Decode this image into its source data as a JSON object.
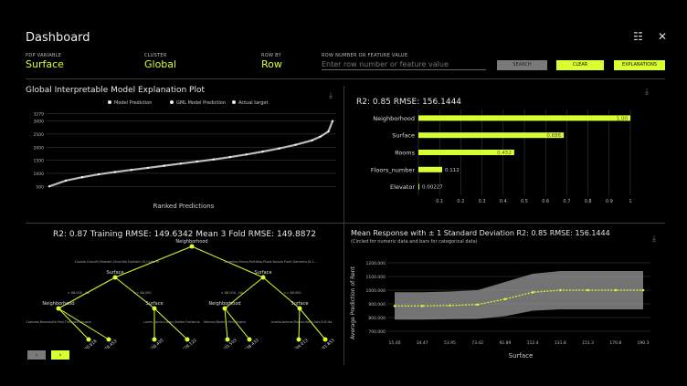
{
  "header": {
    "title": "Dashboard",
    "grid_icon": "grid-icon",
    "close_icon": "close-icon"
  },
  "controls": {
    "pdp_variable": {
      "label": "PDP VARIABLE",
      "value": "Surface"
    },
    "cluster": {
      "label": "CLUSTER",
      "value": "Global"
    },
    "row_by": {
      "label": "ROW BY",
      "value": "Row"
    },
    "feature": {
      "label": "ROW NUMBER OR FEATURE VALUE",
      "placeholder": "Enter row number or feature value"
    },
    "search_label": "SEARCH",
    "clear_label": "CLEAR",
    "explanations_label": "EXPLANATIONS"
  },
  "panels": {
    "global": {
      "title": "Global Interpretable Model Explanation Plot",
      "xlabel": "Ranked Predictions",
      "legend": [
        "Model Prediction",
        "GML Model Prediction",
        "Actual target"
      ]
    },
    "importance": {
      "title": "R2: 0.85 RMSE: 156.1444"
    },
    "tree": {
      "title": "R2: 0.87 Training RMSE: 149.6342 Mean 3 Fold RMSE: 149.8872",
      "root": "Neighborhood",
      "root_values": "Cavalo,Grocelli,Ramaiti,Chochtik,Dolhalm,SI,Uniform",
      "root_values_right": "Angelino,Parral,Portfolio,Plaza Nuova,Front,Sorrento,St.L...",
      "split_left": "Surface",
      "split_right": "Surface",
      "edge_l1": "< 88.000 , NA",
      "edge_l2": ">= 88.000",
      "edge_r1": "< 88.000 , NA",
      "edge_r2": ">= 88.000",
      "l_neigh": "Neighborhood",
      "l_surf": "Surface",
      "r_neigh": "Neighborhood",
      "r_surf": "Surface",
      "leaf_l_values": "Colorado,Brownsville,Park,Thompson,Angelo",
      "leaf_l_values2": "Lorem,Sanford,Arms,Shelter,Fortlaurio",
      "leaf_r_values": "Marconi,Bodmin,Park,Angelo",
      "leaf_r_values2": "Aurelia,Avenue,Pizzulo,Hosel,Sole,SUE,Ilia",
      "leaves": [
        "930.618",
        "978.453",
        "1106.405",
        "1029.122",
        "1105.503",
        "1038.433",
        "1194.013",
        "1181.853"
      ]
    },
    "pdp": {
      "title": "Mean Response with ± 1 Standard Deviation R2: 0.85 RMSE: 156.1444",
      "subtitle": "(Circled for numeric data and bars for categorical data)",
      "xlabel": "Surface",
      "ylabel": "Average Prediction of Rent"
    }
  },
  "pager": {
    "prev": "‹",
    "next": "›"
  },
  "chart_data": [
    {
      "type": "scatter",
      "title": "Global Interpretable Model Explanation Plot",
      "xlabel": "Ranked Predictions",
      "ylabel": "",
      "yticks": [
        "500",
        "1000",
        "1500",
        "2000",
        "2500",
        "3000",
        "3279"
      ],
      "ylim": [
        300,
        3300
      ],
      "series": [
        {
          "name": "Model Prediction",
          "x": [
            0,
            20,
            40,
            60,
            80,
            100,
            120,
            140,
            160,
            180,
            200,
            220,
            240,
            260,
            280,
            300,
            320,
            330,
            340,
            345
          ],
          "y": [
            500,
            720,
            850,
            960,
            1050,
            1130,
            1210,
            1290,
            1370,
            1450,
            1530,
            1620,
            1720,
            1830,
            1950,
            2090,
            2260,
            2400,
            2600,
            3000
          ]
        }
      ],
      "grid": true
    },
    {
      "type": "bar",
      "title": "R2: 0.85 RMSE: 156.1444",
      "orientation": "horizontal",
      "categories": [
        "Neighborhood",
        "Surface",
        "Rooms",
        "Floors_number",
        "Elevator"
      ],
      "values": [
        1.0,
        0.686,
        0.452,
        0.112,
        0.00227
      ],
      "labels": [
        "1.00",
        "0.686",
        "0.452",
        "0.112",
        "0.00227"
      ],
      "xticks": [
        "0.1",
        "0.2",
        "0.3",
        "0.4",
        "0.5",
        "0.6",
        "0.7",
        "0.8",
        "0.9",
        "1"
      ],
      "xlim": [
        0,
        1.0
      ],
      "grid": true
    },
    {
      "type": "line",
      "title": "Mean Response with ± 1 Standard Deviation R2: 0.85 RMSE: 156.1444",
      "xlabel": "Surface",
      "ylabel": "Average Prediction of Rent",
      "categories": [
        "15.00",
        "34.47",
        "53.95",
        "73.42",
        "92.89",
        "112.4",
        "131.8",
        "151.3",
        "170.8",
        "190.3"
      ],
      "yticks": [
        "700.000",
        "800.000",
        "900.000",
        "1000.000",
        "1100.000",
        "1200.000"
      ],
      "ylim": [
        680,
        1240
      ],
      "series": [
        {
          "name": "Mean",
          "values": [
            885,
            885,
            888,
            895,
            935,
            985,
            1000,
            1000,
            1000,
            1000
          ],
          "upper": [
            985,
            985,
            990,
            1000,
            1060,
            1120,
            1140,
            1140,
            1140,
            1140
          ],
          "lower": [
            785,
            785,
            788,
            790,
            810,
            850,
            860,
            860,
            860,
            860
          ]
        }
      ],
      "grid": true
    }
  ]
}
